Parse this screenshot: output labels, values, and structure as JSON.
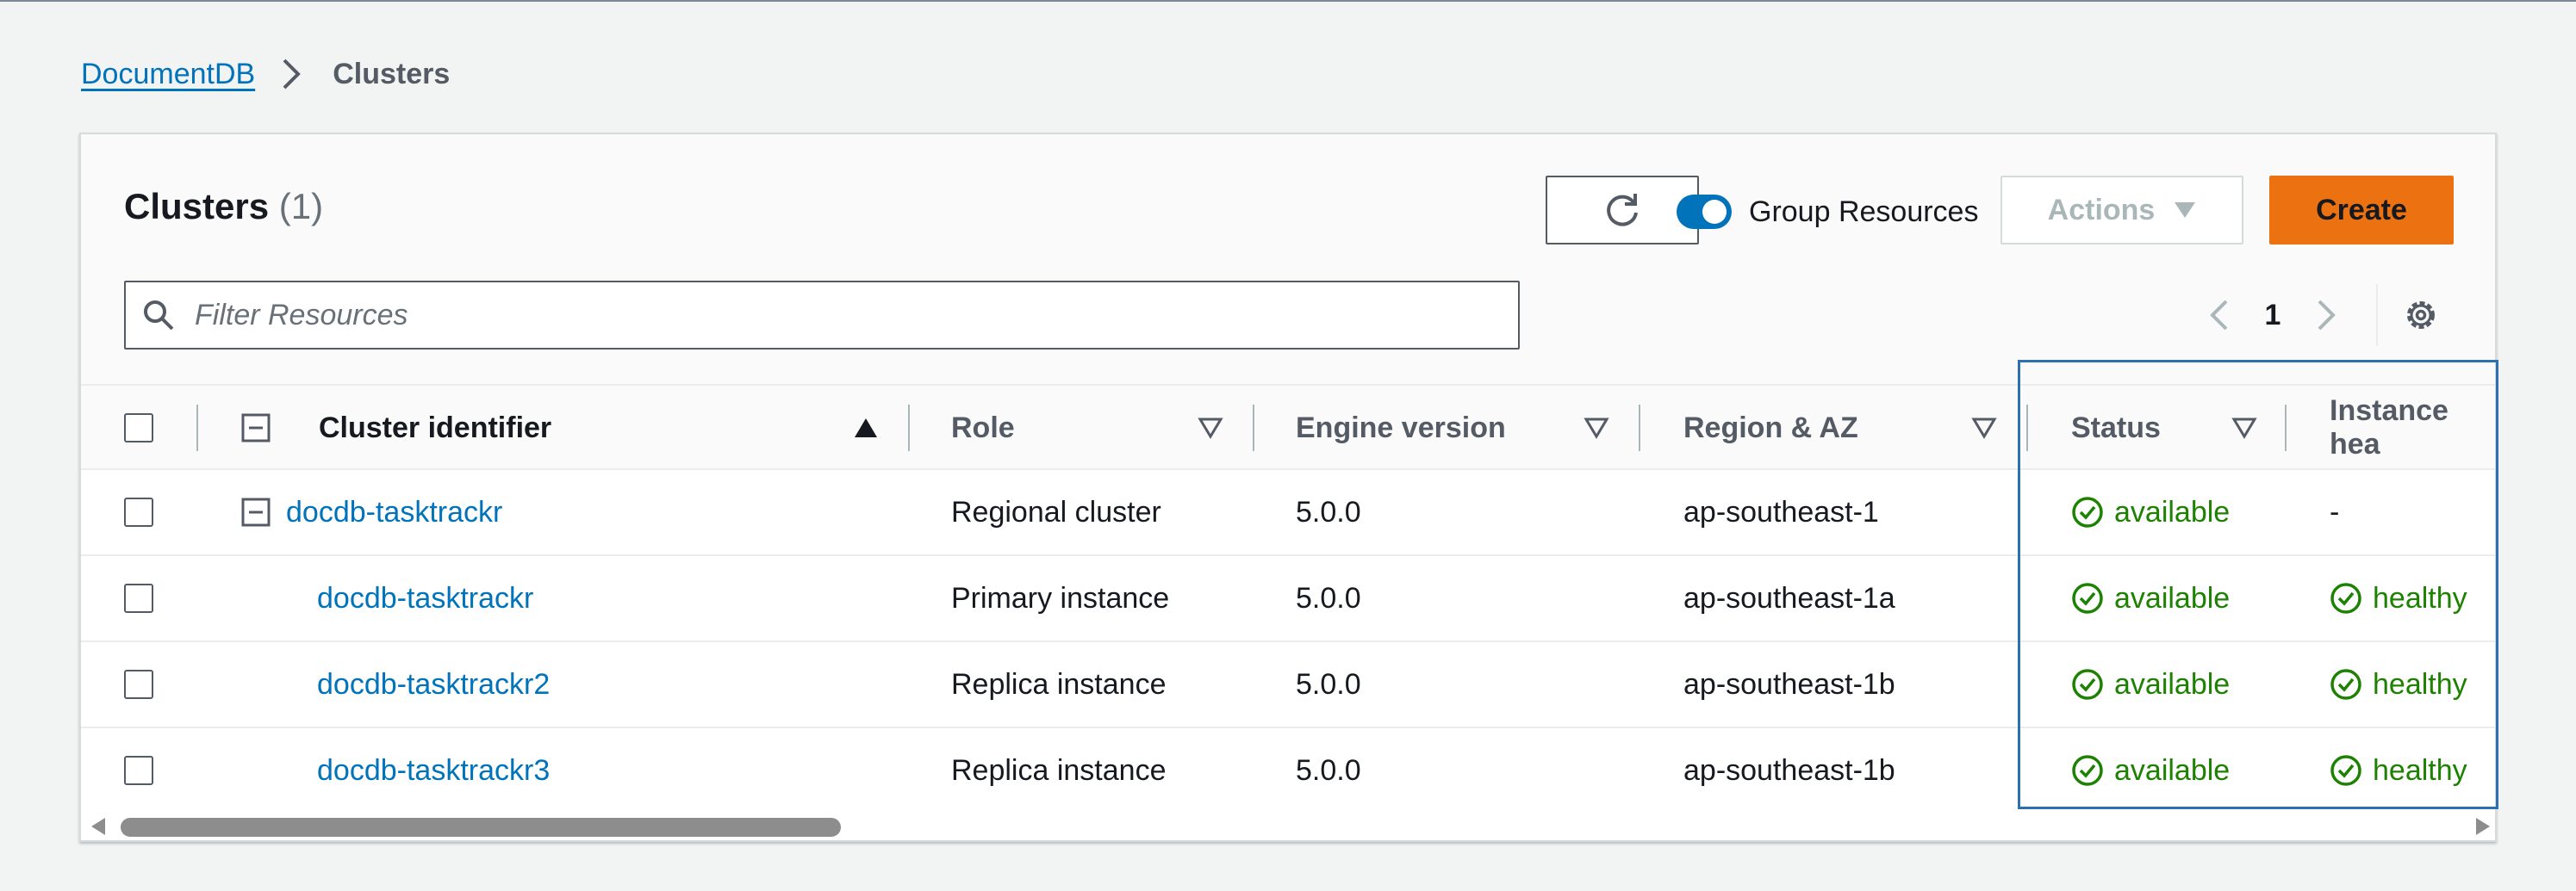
{
  "breadcrumb": {
    "parent": "DocumentDB",
    "current": "Clusters"
  },
  "panel": {
    "title": "Clusters",
    "count": "(1)",
    "toggle_label": "Group Resources",
    "actions_label": "Actions",
    "create_label": "Create",
    "search_placeholder": "Filter Resources",
    "page_number": "1"
  },
  "table": {
    "headers": {
      "identifier": "Cluster identifier",
      "role": "Role",
      "engine": "Engine version",
      "region": "Region & AZ",
      "status": "Status",
      "health": "Instance hea"
    },
    "rows": [
      {
        "identifier": "docdb-tasktrackr",
        "role": "Regional cluster",
        "engine": "5.0.0",
        "region": "ap-southeast-1",
        "status": "available",
        "health": "-"
      },
      {
        "identifier": "docdb-tasktrackr",
        "role": "Primary instance",
        "engine": "5.0.0",
        "region": "ap-southeast-1a",
        "status": "available",
        "health": "healthy"
      },
      {
        "identifier": "docdb-tasktrackr2",
        "role": "Replica instance",
        "engine": "5.0.0",
        "region": "ap-southeast-1b",
        "status": "available",
        "health": "healthy"
      },
      {
        "identifier": "docdb-tasktrackr3",
        "role": "Replica instance",
        "engine": "5.0.0",
        "region": "ap-southeast-1b",
        "status": "available",
        "health": "healthy"
      }
    ]
  },
  "colors": {
    "link": "#0073bb",
    "primary_button": "#ec7211",
    "success": "#1d8102",
    "highlight": "#2e6fb0"
  },
  "icons": [
    "chevron-right-icon",
    "refresh-icon",
    "caret-down-icon",
    "search-icon",
    "chevron-left-icon",
    "gear-icon",
    "collapse-icon",
    "sort-ascending-icon",
    "sort-icon",
    "status-success-icon",
    "scroll-left-icon",
    "scroll-right-icon"
  ]
}
